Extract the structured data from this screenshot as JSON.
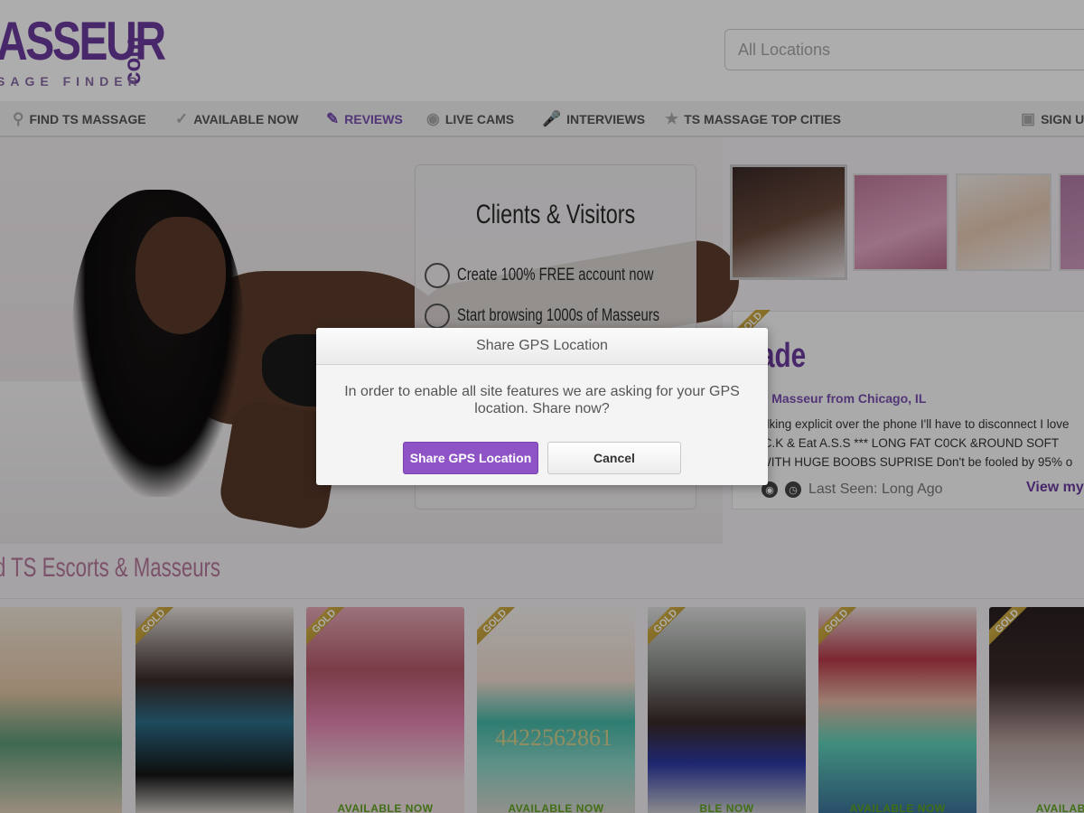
{
  "header": {
    "logo_main": "ASSEUR",
    "logo_com": "com",
    "logo_sub": "SAGE FINDER",
    "search_placeholder": "All Locations"
  },
  "nav": {
    "items": [
      {
        "label": "FIND TS MASSAGE",
        "icon": "search-icon"
      },
      {
        "label": "AVAILABLE NOW",
        "icon": "check-icon"
      },
      {
        "label": "REVIEWS",
        "icon": "edit-icon",
        "active": true
      },
      {
        "label": "LIVE CAMS",
        "icon": "webcam-icon"
      },
      {
        "label": "INTERVIEWS",
        "icon": "microphone-icon"
      },
      {
        "label": "TS MASSAGE TOP CITIES",
        "icon": "star-icon"
      },
      {
        "label": "SIGN U",
        "icon": "facebook-icon"
      }
    ]
  },
  "hero": {
    "board_title": "Clients & Visitors",
    "board_items": [
      "Create 100% FREE account now",
      "Start browsing 1000s of Masseurs"
    ]
  },
  "profile": {
    "name": "ade",
    "badge": "GOLD",
    "subtitle": "S Masseur from Chicago, IL",
    "desc_lines": [
      "alking explicit over the phone I'll have to disconnect I love",
      ".C.K & Eat A.S.S *** LONG FAT C0CK &ROUND SOFT",
      "WITH HUGE BOOBS SUPRISE Don't be fooled by 95% o"
    ],
    "last_seen": "Last Seen: Long Ago",
    "view_link": "View my"
  },
  "section": {
    "title": "d TS Escorts & Masseurs"
  },
  "cards": [
    {
      "gold": false,
      "available": "",
      "watermark": ""
    },
    {
      "gold": true,
      "available": "",
      "watermark": ""
    },
    {
      "gold": true,
      "available": "AVAILABLE NOW",
      "watermark": ""
    },
    {
      "gold": true,
      "available": "AVAILABLE NOW",
      "watermark": "4422562861"
    },
    {
      "gold": true,
      "available": "BLE NOW",
      "watermark": ""
    },
    {
      "gold": true,
      "available": "AVAILABLE NOW",
      "watermark": ""
    },
    {
      "gold": true,
      "available": "AVAILABLE",
      "watermark": ""
    }
  ],
  "modal": {
    "title": "Share GPS Location",
    "message_line1": "In order to enable all site features we are asking for your GPS",
    "message_line2": "location. Share now?",
    "share_button": "Share GPS Location",
    "cancel_button": "Cancel"
  },
  "colors": {
    "brand": "#6b3a9c",
    "accent_button": "#8e54c6",
    "available_green": "#5fa41f",
    "gold": "#c9a233"
  }
}
